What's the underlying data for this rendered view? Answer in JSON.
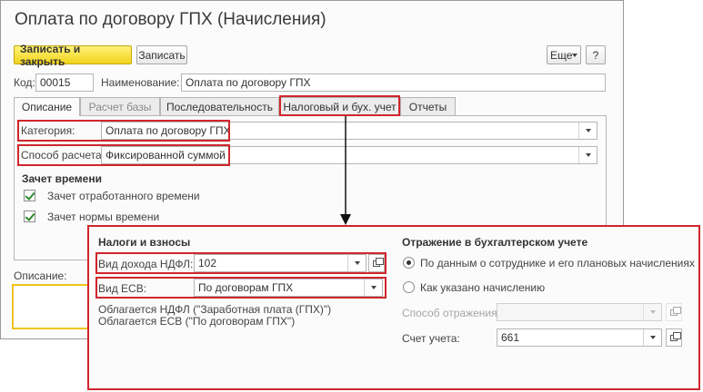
{
  "window": {
    "title": "Оплата по договору ГПХ (Начисления)"
  },
  "toolbar": {
    "save_close_label": "Записать и закрыть",
    "save_label": "Записать",
    "more_label": "Еще",
    "help_label": "?"
  },
  "header": {
    "code_label": "Код:",
    "code_value": "00015",
    "name_label": "Наименование:",
    "name_value": "Оплата по договору ГПХ"
  },
  "tabs": [
    {
      "label": "Описание"
    },
    {
      "label": "Расчет базы"
    },
    {
      "label": "Последовательность"
    },
    {
      "label": "Налоговый и бух. учет"
    },
    {
      "label": "Отчеты"
    }
  ],
  "description_tab": {
    "category_label": "Категория:",
    "category_value": "Оплата по договору ГПХ",
    "method_label": "Способ расчета:",
    "method_value": "Фиксированной суммой",
    "time_section": "Зачет времени",
    "worked_time_label": "Зачет отработанного времени",
    "norm_time_label": "Зачет нормы времени"
  },
  "description_field": {
    "label": "Описание:"
  },
  "tax_popup": {
    "taxes_section": "Налоги и взносы",
    "ndfl_label": "Вид дохода НДФЛ:",
    "ndfl_value": "102",
    "esv_label": "Вид ЕСВ:",
    "esv_value": "По договорам ГПХ",
    "note_ndfl": "Облагается НДФЛ (\"Заработная плата (ГПХ)\")",
    "note_esv": "Облагается ЕСВ (\"По договорам ГПХ\")",
    "accounting_section": "Отражение в бухгалтерском учете",
    "radio_by_employee": "По данным о сотруднике и его плановых начислениях",
    "radio_as_specified": "Как указано начислению",
    "reflection_label": "Способ отражения:",
    "reflection_value": "",
    "account_label": "Счет учета:",
    "account_value": "661"
  },
  "colors": {
    "highlight": "#d0262c",
    "primary_button": "#f1d41b",
    "input_focus": "#f0c419"
  }
}
